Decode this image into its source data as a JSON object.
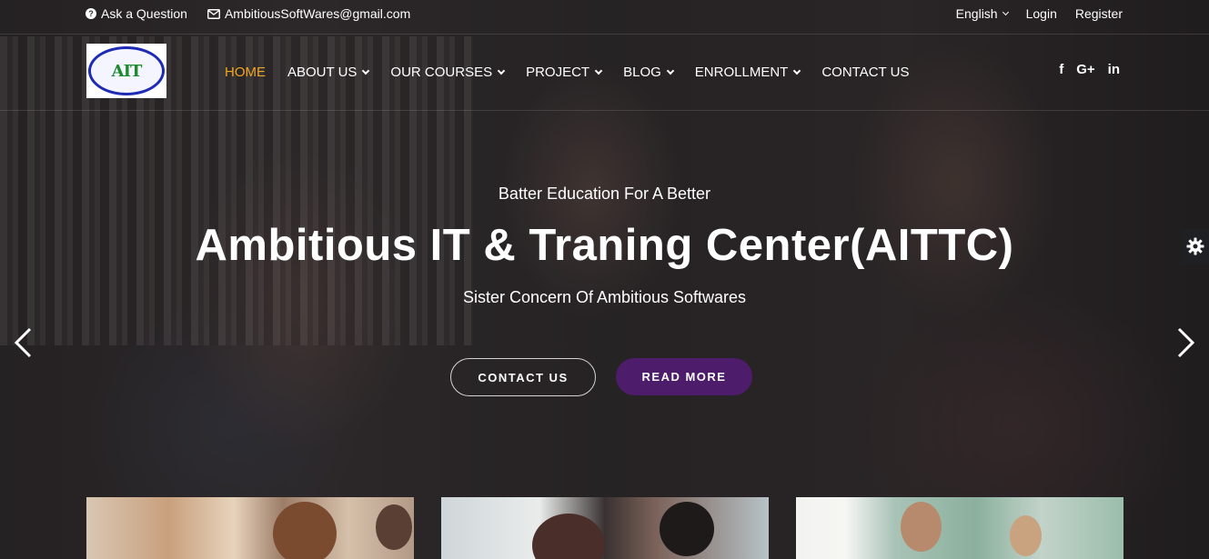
{
  "topbar": {
    "ask_label": "Ask a Question",
    "email": "AmbitiousSoftWares@gmail.com",
    "language": "English",
    "login": "Login",
    "register": "Register"
  },
  "nav": {
    "logo_initials": "AIT",
    "items": [
      {
        "label": "HOME",
        "active": true
      },
      {
        "label": "ABOUT US"
      },
      {
        "label": "OUR COURSES"
      },
      {
        "label": "PROJECT"
      },
      {
        "label": "BLOG"
      },
      {
        "label": "ENROLLMENT"
      },
      {
        "label": "CONTACT US"
      }
    ],
    "social": [
      "f",
      "G+",
      "in"
    ]
  },
  "hero": {
    "tagline": "Batter Education For A Better",
    "headline": "Ambitious IT & Traning Center(AITTC)",
    "subline": "Sister Concern Of Ambitious Softwares",
    "contact_button": "CONTACT US",
    "read_more_button": "READ MORE"
  },
  "colors": {
    "accent": "#f0a51f",
    "button_purple": "#4d1c6a"
  },
  "icons": {
    "question": "question-circle-icon",
    "email": "envelope-icon",
    "prev": "chevron-left-icon",
    "next": "chevron-right-icon",
    "settings": "gear-icon"
  }
}
